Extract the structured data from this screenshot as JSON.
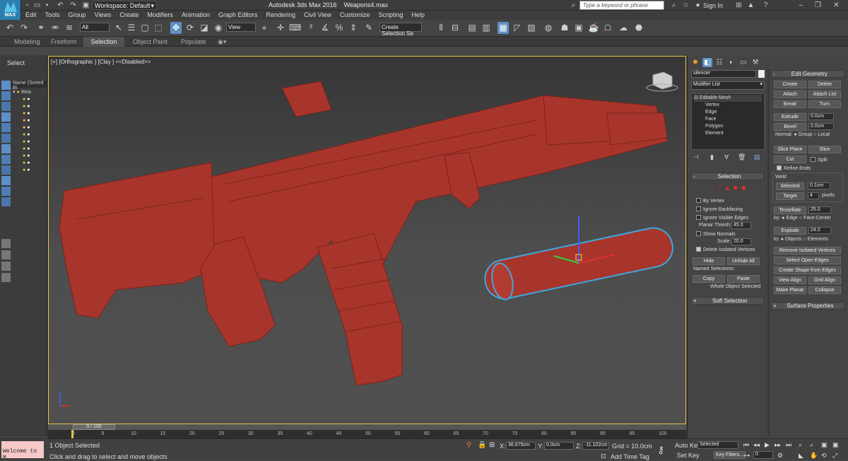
{
  "window": {
    "title": "Autodesk 3ds Max 2016",
    "file": "Weapons4.max",
    "logo": "MAX"
  },
  "workspace": "Workspace: Default",
  "search_placeholder": "Type a keyword or phrase",
  "signin": "Sign In",
  "menus": [
    "Edit",
    "Tools",
    "Group",
    "Views",
    "Create",
    "Modifiers",
    "Animation",
    "Graph Editors",
    "Rendering",
    "Civil View",
    "Customize",
    "Scripting",
    "Help"
  ],
  "toolbar": {
    "filter": "All",
    "refcoord": "View",
    "selset": "Create Selection Se"
  },
  "ribbon_tabs": [
    "Modeling",
    "Freeform",
    "Selection",
    "Object Paint",
    "Populate"
  ],
  "explorer": {
    "tab": "Select",
    "header": "Name (Sorted Bi",
    "root": "Wea"
  },
  "viewport": {
    "label": "[+] [Orthographic ] [Clay ] <<Disabled>>"
  },
  "cmd": {
    "object_name": "silencer",
    "modifier_list": "Modifier List",
    "stack": [
      "Editable Mesh",
      "Vertex",
      "Edge",
      "Face",
      "Polygon",
      "Element"
    ],
    "selection": {
      "title": "Selection",
      "by_vertex": "By Vertex",
      "ignore_backfacing": "Ignore Backfacing",
      "ignore_visible": "Ignore Visible Edges",
      "planar_label": "Planar Thresh:",
      "planar": "45.0",
      "show_normals": "Show Normals",
      "scale_label": "Scale:",
      "scale": "20.0",
      "delete_iso": "Delete Isolated Vertices",
      "hide": "Hide",
      "unhide": "Unhide All",
      "named_sel": "Named Selections:",
      "copy": "Copy",
      "paste": "Paste",
      "status": "Whole Object Selected"
    },
    "soft_selection": "Soft Selection",
    "edit_geometry": {
      "title": "Edit Geometry",
      "create": "Create",
      "delete": "Delete",
      "attach": "Attach",
      "attach_list": "Attach List",
      "break": "Break",
      "turn": "Turn",
      "extrude": "Extrude",
      "extrude_val": "0.0cm",
      "bevel": "Bevel",
      "bevel_val": "0.0cm",
      "normal": "Normal:",
      "group": "Group",
      "local": "Local",
      "slice_plane": "Slice Plane",
      "slice": "Slice",
      "cut": "Cut",
      "split": "Split",
      "refine": "Refine Ends",
      "weld": "Weld",
      "selected": "Selected",
      "selected_val": "0.1cm",
      "target": "Target",
      "target_val": "4",
      "pixels": "pixels",
      "tessellate": "Tessellate",
      "tess_val": "25.0",
      "by": "by:",
      "edge": "Edge",
      "face_center": "Face-Center",
      "explode": "Explode",
      "explode_val": "24.0",
      "to": "to:",
      "objects": "Objects",
      "elements": "Elements",
      "remove_iso": "Remove Isolated Vertices",
      "select_open": "Select Open Edges",
      "create_shape": "Create Shape from Edges",
      "view_align": "View Align",
      "grid_align": "Grid Align",
      "make_planar": "Make Planar",
      "collapse": "Collapse"
    },
    "surface_props": "Surface Properties"
  },
  "timeline": {
    "frame": "0 / 100",
    "ticks": [
      "0",
      "5",
      "10",
      "15",
      "20",
      "25",
      "30",
      "35",
      "40",
      "45",
      "50",
      "55",
      "60",
      "65",
      "70",
      "75",
      "80",
      "85",
      "90",
      "95",
      "100"
    ]
  },
  "status": {
    "listener": "Welcome to M",
    "objects": "1 Object Selected",
    "prompt": "Click and drag to select and move objects",
    "x": "36.675cm",
    "y": "0.0cm",
    "z": "-11.102cm",
    "grid": "Grid = 10.0cm",
    "add_time_tag": "Add Time Tag",
    "auto_key": "Auto Key",
    "set_key": "Set Key",
    "selected": "Selected",
    "key_filters": "Key Filters...",
    "frame": "0"
  }
}
